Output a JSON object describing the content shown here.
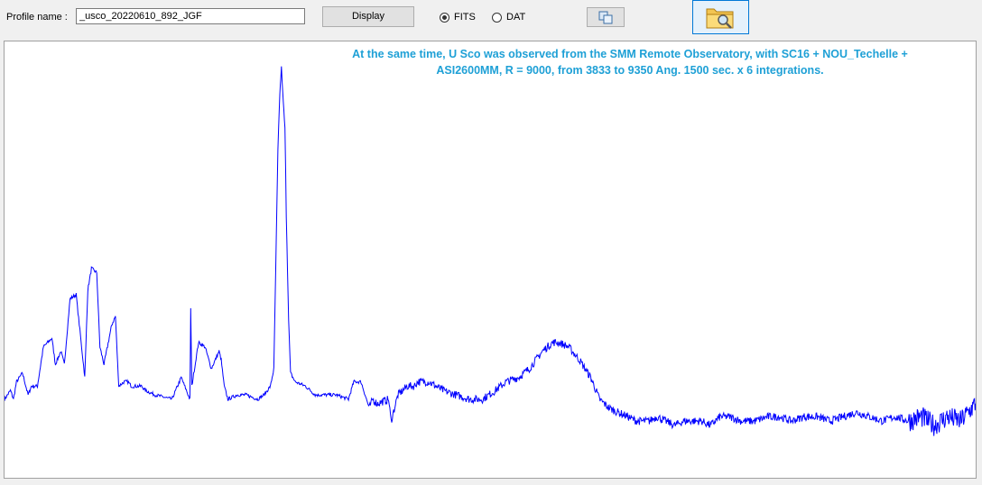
{
  "toolbar": {
    "profile_label": "Profile name :",
    "profile_value": "_usco_20220610_892_JGF",
    "display_label": "Display",
    "radio_fits_label": "FITS",
    "radio_dat_label": "DAT",
    "selected_format": "FITS"
  },
  "colors": {
    "spectrum": "#0000ff",
    "annotation": "#1ea0d6",
    "selected_button_border": "#0078d7"
  },
  "annotation": {
    "line1": "At the same time, U Sco was observed from the SMM  Remote Observatory, with SC16 + NOU_Techelle +",
    "line2": "ASI2600MM, R = 9000,  from 3833 to 9350 Ang. 1500 sec. x 6 integrations."
  },
  "chart_data": {
    "type": "line",
    "grid": false,
    "x_range": [
      3833,
      9350
    ],
    "y_range": [
      0,
      1
    ],
    "series": [
      {
        "x": [
          3833,
          3867,
          3884,
          3901,
          3935,
          3967,
          3986,
          4020,
          4054,
          4102,
          4122,
          4153,
          4173,
          4205,
          4240,
          4289,
          4306,
          4327,
          4357,
          4375,
          4398,
          4442,
          4463,
          4482,
          4513,
          4534,
          4554,
          4576,
          4611,
          4634,
          4688,
          4784,
          4837,
          4886,
          4891,
          4897,
          4935,
          4972,
          5008,
          5052,
          5064,
          5081,
          5102,
          5155,
          5205,
          5272,
          5307,
          5344,
          5363,
          5374,
          5386,
          5397,
          5406,
          5414,
          5426,
          5434,
          5447,
          5458,
          5484,
          5543,
          5598,
          5651,
          5717,
          5787,
          5817,
          5858,
          5905,
          5925,
          5950,
          6015,
          6029,
          6068,
          6121,
          6160,
          6180,
          6242,
          6326,
          6398,
          6475,
          6548,
          6621,
          6683,
          6753,
          6814,
          6889,
          6945,
          6983,
          7038,
          7099,
          7163,
          7213,
          7267,
          7317,
          7375,
          7423,
          7459,
          7496,
          7539,
          7589,
          7640,
          7691,
          7742,
          7792,
          7843,
          7898,
          7953,
          8018,
          8093,
          8170,
          8236,
          8302,
          8376,
          8450,
          8524,
          8598,
          8672,
          8746,
          8820,
          8894,
          8968,
          9042,
          9116,
          9190,
          9264,
          9350
        ],
        "y": [
          0.18,
          0.2,
          0.18,
          0.22,
          0.24,
          0.19,
          0.21,
          0.21,
          0.3,
          0.32,
          0.26,
          0.29,
          0.26,
          0.41,
          0.42,
          0.23,
          0.43,
          0.48,
          0.47,
          0.3,
          0.26,
          0.35,
          0.37,
          0.21,
          0.22,
          0.22,
          0.21,
          0.21,
          0.21,
          0.2,
          0.19,
          0.18,
          0.23,
          0.18,
          0.39,
          0.21,
          0.31,
          0.3,
          0.25,
          0.29,
          0.27,
          0.21,
          0.18,
          0.19,
          0.19,
          0.18,
          0.19,
          0.21,
          0.25,
          0.48,
          0.75,
          0.88,
          0.94,
          0.88,
          0.8,
          0.6,
          0.36,
          0.24,
          0.22,
          0.21,
          0.19,
          0.19,
          0.19,
          0.18,
          0.22,
          0.22,
          0.16,
          0.18,
          0.17,
          0.18,
          0.13,
          0.19,
          0.21,
          0.21,
          0.22,
          0.22,
          0.2,
          0.19,
          0.18,
          0.18,
          0.2,
          0.22,
          0.23,
          0.25,
          0.29,
          0.31,
          0.31,
          0.3,
          0.27,
          0.23,
          0.18,
          0.16,
          0.15,
          0.14,
          0.13,
          0.13,
          0.13,
          0.14,
          0.13,
          0.12,
          0.13,
          0.13,
          0.13,
          0.12,
          0.14,
          0.14,
          0.13,
          0.13,
          0.14,
          0.14,
          0.13,
          0.14,
          0.14,
          0.13,
          0.14,
          0.15,
          0.14,
          0.13,
          0.14,
          0.13,
          0.14,
          0.12,
          0.14,
          0.13,
          0.17
        ]
      }
    ]
  }
}
